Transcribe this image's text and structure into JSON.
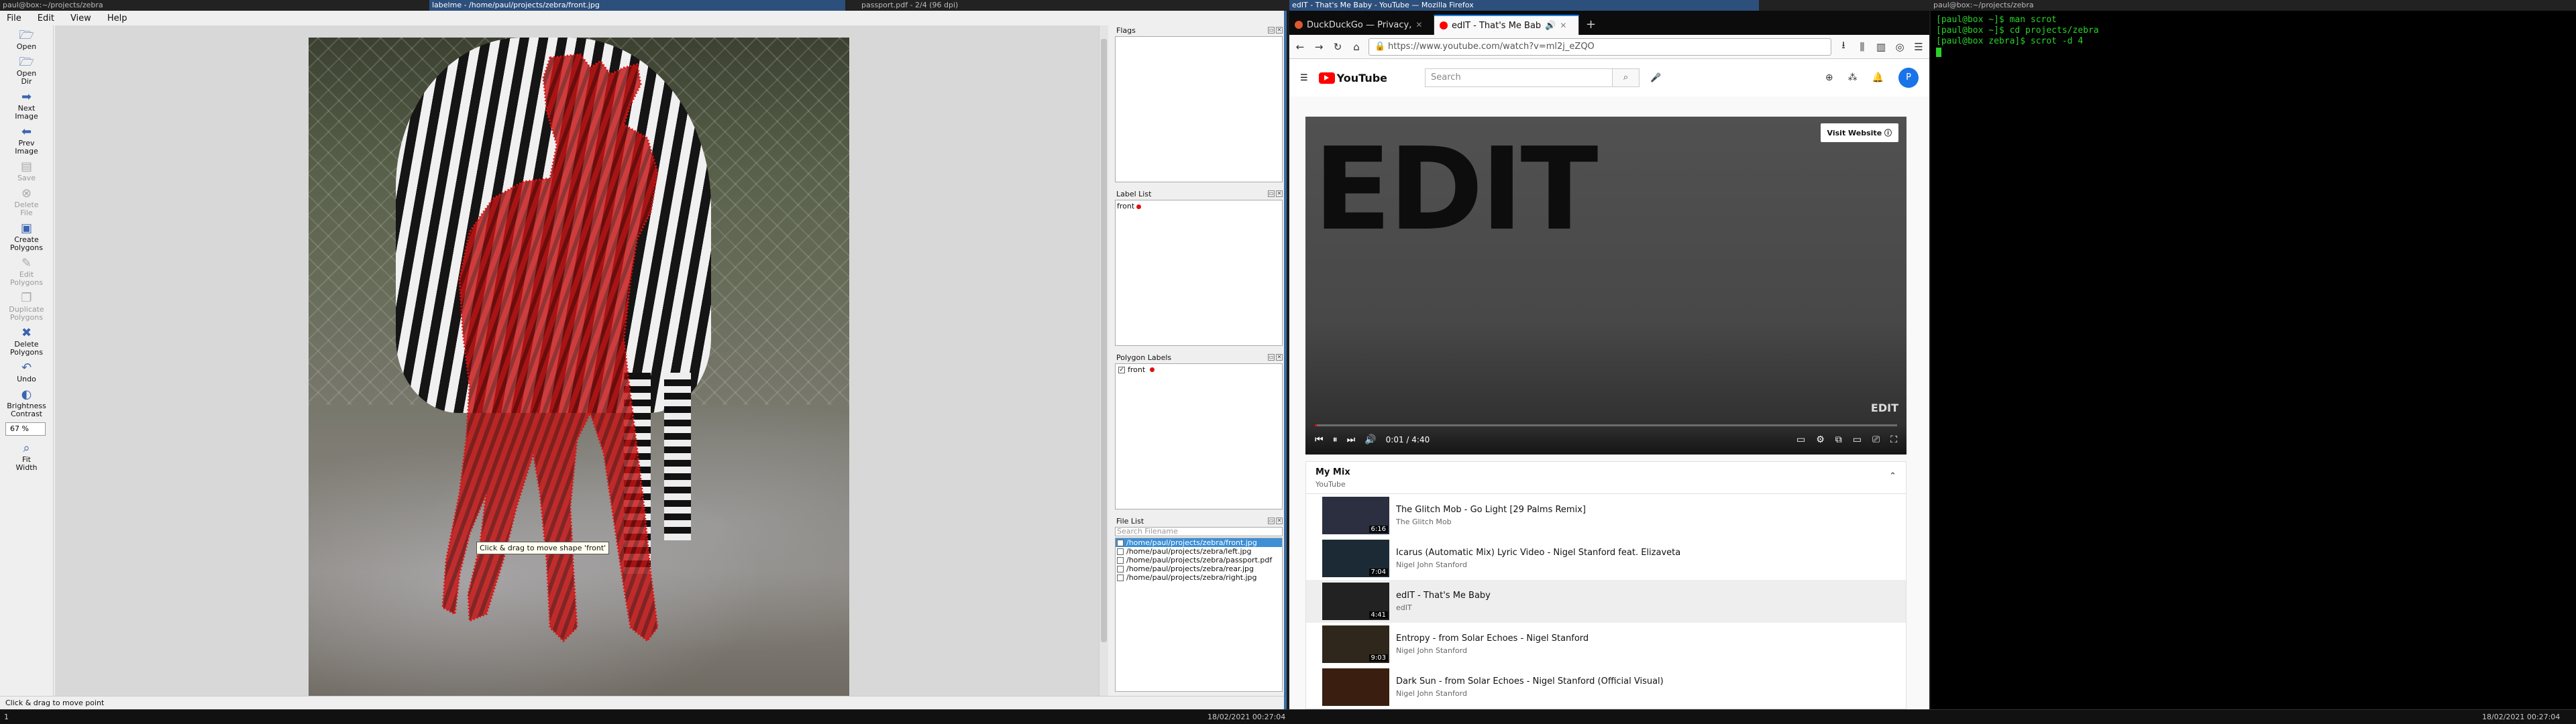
{
  "topbar": {
    "left_title": "paul@box:~/projects/zebra",
    "labelme_title": "labelme - /home/paul/projects/zebra/front.jpg",
    "pdf_title": "passport.pdf - 2/4 (96 dpi)",
    "firefox_title": "edIT - That's Me Baby - YouTube — Mozilla Firefox",
    "terminal_title": "paul@box:~/projects/zebra"
  },
  "labelme": {
    "menu": [
      "File",
      "Edit",
      "View",
      "Help"
    ],
    "tools": [
      {
        "label": "Open",
        "icon": "open-icon",
        "glyph": "🗁",
        "enabled": true
      },
      {
        "label": "Open\nDir",
        "icon": "open-dir-icon",
        "glyph": "🗁",
        "enabled": true
      },
      {
        "label": "Next\nImage",
        "icon": "next-image-icon",
        "glyph": "➡",
        "enabled": true
      },
      {
        "label": "Prev\nImage",
        "icon": "prev-image-icon",
        "glyph": "⬅",
        "enabled": true
      },
      {
        "label": "Save",
        "icon": "save-icon",
        "glyph": "▤",
        "enabled": false
      },
      {
        "label": "Delete\nFile",
        "icon": "delete-file-icon",
        "glyph": "⊗",
        "enabled": false
      },
      {
        "label": "Create\nPolygons",
        "icon": "create-polygons-icon",
        "glyph": "▣",
        "enabled": true
      },
      {
        "label": "Edit\nPolygons",
        "icon": "edit-polygons-icon",
        "glyph": "✎",
        "enabled": false
      },
      {
        "label": "Duplicate\nPolygons",
        "icon": "duplicate-polygons-icon",
        "glyph": "❐",
        "enabled": false
      },
      {
        "label": "Delete\nPolygons",
        "icon": "delete-polygons-icon",
        "glyph": "✖",
        "enabled": true
      },
      {
        "label": "Undo",
        "icon": "undo-icon",
        "glyph": "↶",
        "enabled": true
      },
      {
        "label": "Brightness\nContrast",
        "icon": "brightness-contrast-icon",
        "glyph": "◐",
        "enabled": true
      }
    ],
    "zoom": "67 %",
    "fit_width": "Fit\nWidth",
    "tooltip": "Click & drag to move shape 'front'",
    "status": "Click & drag to move point",
    "docks": {
      "flags_title": "Flags",
      "label_list_title": "Label List",
      "label_list": [
        "front"
      ],
      "polygon_labels_title": "Polygon Labels",
      "polygon_labels": [
        "front"
      ],
      "file_list_title": "File List",
      "file_search_placeholder": "Search Filename",
      "files": [
        {
          "name": "/home/paul/projects/zebra/front.jpg",
          "checked": true
        },
        {
          "name": "/home/paul/projects/zebra/left.jpg",
          "checked": false
        },
        {
          "name": "/home/paul/projects/zebra/passport.pdf",
          "checked": false
        },
        {
          "name": "/home/paul/projects/zebra/rear.jpg",
          "checked": false
        },
        {
          "name": "/home/paul/projects/zebra/right.jpg",
          "checked": false
        }
      ]
    }
  },
  "firefox": {
    "tabs": [
      {
        "label": "DuckDuckGo — Privacy,",
        "active": false
      },
      {
        "label": "edIT - That's Me Bab",
        "active": true
      }
    ],
    "url": "https://www.youtube.com/watch?v=ml2j_eZQO",
    "youtube": {
      "search_placeholder": "Search",
      "avatar_letter": "P",
      "video_title_art": "EDIT",
      "visit_website": "Visit Website",
      "corner_logo": "EDIT",
      "time": "0:01 / 4:40",
      "progress_fraction": 0.004,
      "mix_title": "My Mix",
      "mix_sub": "YouTube",
      "playlist": [
        {
          "title": "The Glitch Mob - Go Light [29 Palms Remix]",
          "channel": "The Glitch Mob",
          "duration": "6:16",
          "thumb": "#2b2f40"
        },
        {
          "title": "Icarus (Automatic Mix) Lyric Video - Nigel Stanford feat. Elizaveta",
          "channel": "Nigel John Stanford",
          "duration": "7:04",
          "thumb": "#1c2a35"
        },
        {
          "title": "edIT - That's Me Baby",
          "channel": "edIT",
          "duration": "4:41",
          "thumb": "#222"
        },
        {
          "title": "Entropy - from Solar Echoes - Nigel Stanford",
          "channel": "Nigel John Stanford",
          "duration": "9:03",
          "thumb": "#30271c"
        },
        {
          "title": "Dark Sun - from Solar Echoes - Nigel Stanford (Official Visual)",
          "channel": "Nigel John Stanford",
          "duration": "",
          "thumb": "#3a1f10"
        }
      ]
    }
  },
  "terminal": {
    "lines": [
      "[paul@box ~]$ man scrot",
      "[paul@box ~]$ cd projects/zebra",
      "[paul@box zebra]$ scrot -d 4"
    ]
  },
  "statusbar": {
    "left_ws": "1",
    "clock_left": "18/02/2021 00:27:04",
    "clock_right": "18/02/2021 00:27:04"
  },
  "colors": {
    "polygon_fill": "#c81414",
    "terminal_green": "#2bd12b",
    "yt_red": "#ff0000"
  }
}
